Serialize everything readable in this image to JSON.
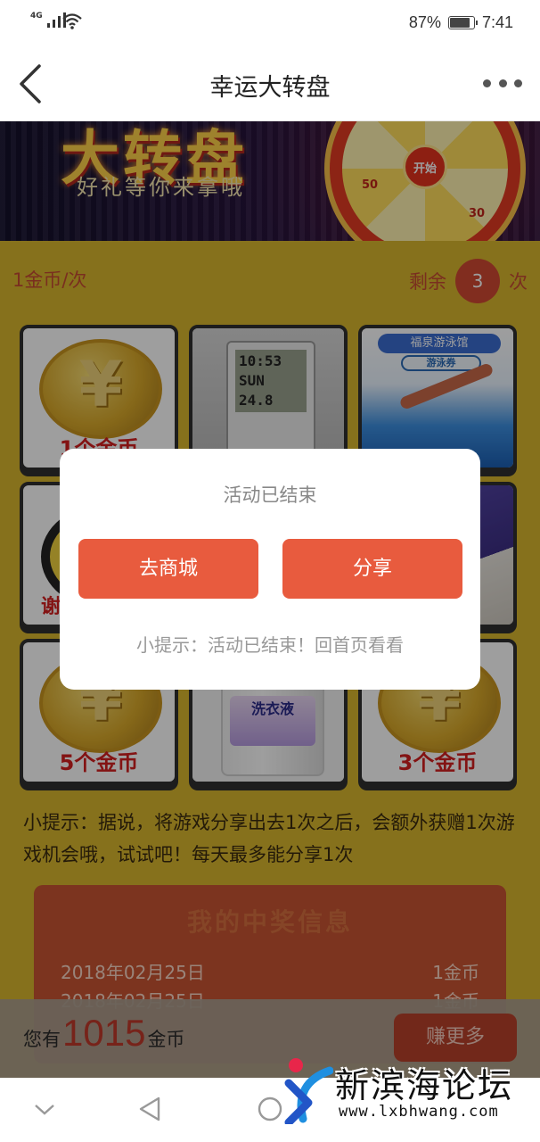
{
  "status_bar": {
    "network": "4G",
    "battery": "87%",
    "battery_level": 0.87,
    "time": "7:41"
  },
  "navbar": {
    "title": "幸运大转盘",
    "back_icon": "chevron-left-icon",
    "more_icon": "more-dots-icon"
  },
  "banner": {
    "title": "大转盘",
    "subtitle": "好礼等你来拿哦",
    "wheel_start": "开始",
    "wheel_labels": [
      "50",
      "30"
    ]
  },
  "game": {
    "cost_label": "1金币/次",
    "remaining_prefix": "剩余",
    "remaining_count": "3",
    "remaining_suffix": "次",
    "prizes": [
      {
        "label": "1个金币"
      },
      {
        "label": "时钟"
      },
      {
        "label": "福泉游泳馆",
        "tag": "游泳券"
      },
      {
        "label": "谢"
      },
      {
        "label": "雨伞"
      },
      {
        "label": "5个金币"
      },
      {
        "label": "洗衣液"
      },
      {
        "label": "3个金币"
      }
    ],
    "clock_screen": [
      "10:53",
      "SUN",
      "24.8"
    ]
  },
  "tip": "小提示：据说，将游戏分享出去1次之后，会额外获赠1次游戏机会哦，试试吧！每天最多能分享1次",
  "records": {
    "title": "我的中奖信息",
    "rows": [
      {
        "date": "2018年02月25日",
        "prize": "1金币"
      },
      {
        "date": "2018年02月25日",
        "prize": "1金币"
      }
    ]
  },
  "coin_bar": {
    "prefix": "您有",
    "amount": "1015",
    "suffix": "金币",
    "earn_button": "赚更多"
  },
  "dialog": {
    "title": "活动已结束",
    "mall_button": "去商城",
    "share_button": "分享",
    "tip": "小提示：活动已结束！回首页看看"
  },
  "watermark": {
    "name": "新滨海论坛",
    "url": "www.lxbhwang.com"
  },
  "colors": {
    "accent": "#e85b3e",
    "panel": "#d8b62e",
    "coin_red": "#c0392b"
  }
}
